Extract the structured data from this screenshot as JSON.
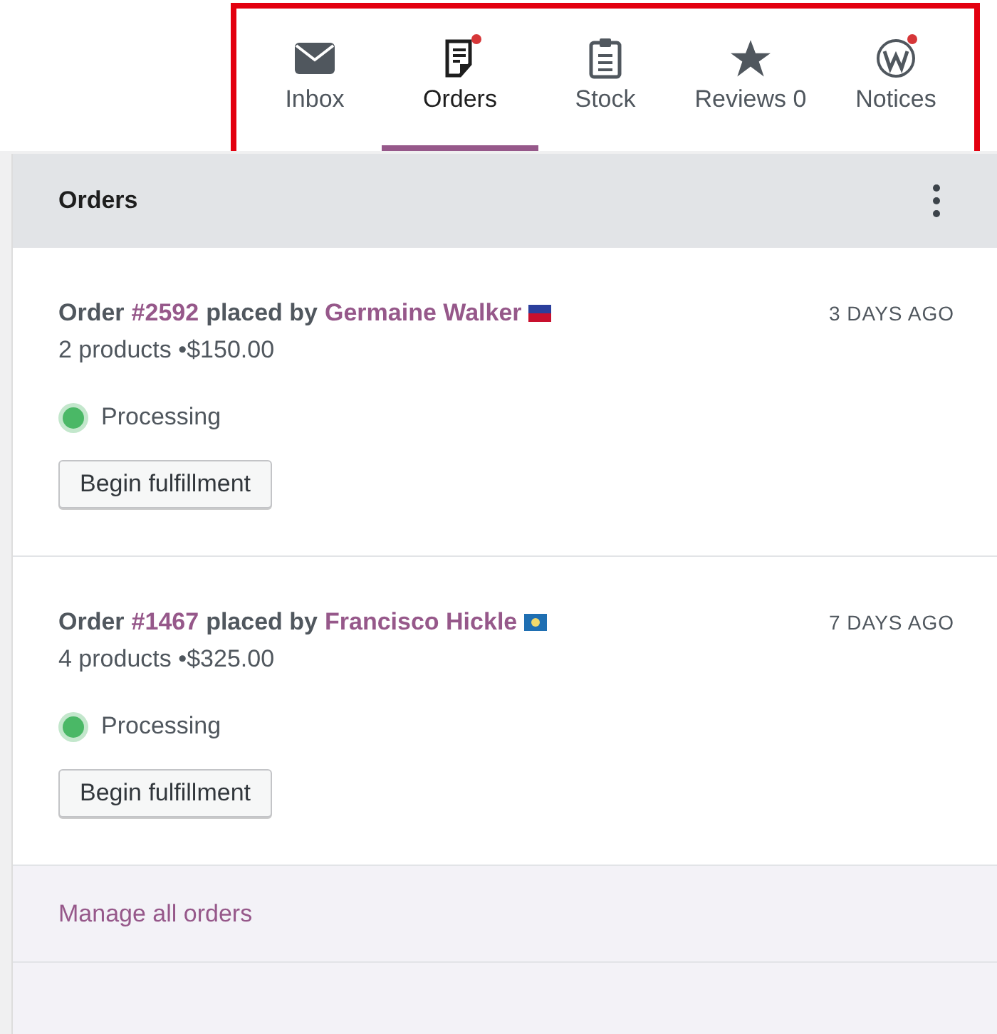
{
  "tabs": [
    {
      "label": "Inbox",
      "kind": "envelope",
      "selected": false,
      "notification": false
    },
    {
      "label": "Orders",
      "kind": "document",
      "selected": true,
      "notification": true
    },
    {
      "label": "Stock",
      "kind": "clipboard",
      "selected": false,
      "notification": false
    },
    {
      "label": "Reviews 0",
      "kind": "star",
      "selected": false,
      "notification": false
    },
    {
      "label": "Notices",
      "kind": "logo",
      "selected": false,
      "notification": true
    }
  ],
  "panel": {
    "title": "Orders"
  },
  "orders": [
    {
      "prefix": "Order",
      "number": "#2592",
      "by": "placed by",
      "customer": "Germaine Walker",
      "products": "2 products",
      "total": "•$150.00",
      "time": "3 DAYS AGO",
      "status": {
        "label": "Processing",
        "color": "#4ab866"
      },
      "action": "Begin fulfillment"
    },
    {
      "prefix": "Order",
      "number": "#1467",
      "by": "placed by",
      "customer": "Francisco Hickle",
      "products": "4 products",
      "total": "•$325.00",
      "time": "7 DAYS AGO",
      "status": {
        "label": "Processing",
        "color": "#4ab866"
      },
      "action": "Begin fulfillment"
    }
  ],
  "footer": {
    "link": "Manage all orders"
  }
}
